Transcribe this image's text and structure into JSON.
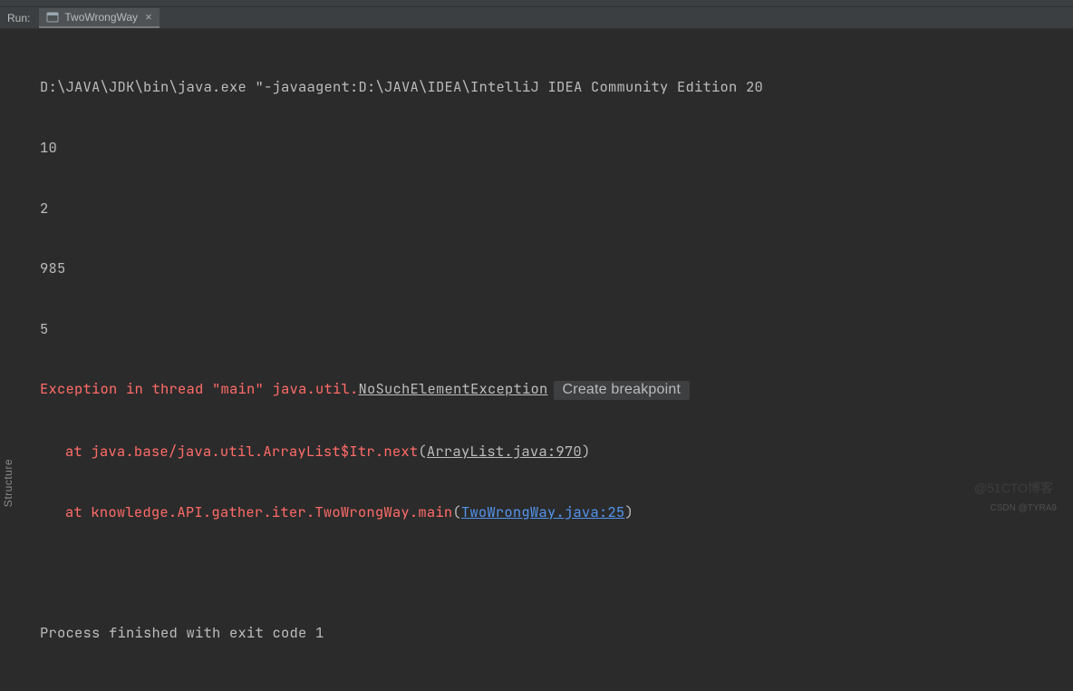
{
  "header": {
    "run_label": "Run:",
    "tab_name": "TwoWrongWay"
  },
  "console": {
    "cmd": "D:\\JAVA\\JDK\\bin\\java.exe \"-javaagent:D:\\JAVA\\IDEA\\IntelliJ IDEA Community Edition 20",
    "out1": "10",
    "out2": "2",
    "out3": "985",
    "out4": "5",
    "exception": {
      "prefix": "Exception in thread \"main\" java.util.",
      "class_link": "NoSuchElementException",
      "breakpoint_label": "Create breakpoint",
      "trace1_prefix": "at java.base/java.util.ArrayList$Itr.next",
      "trace1_open": "(",
      "trace1_link": "ArrayList.java:970",
      "trace1_close": ")",
      "trace2_prefix": "at knowledge.API.gather.iter.TwoWrongWay.main",
      "trace2_open": "(",
      "trace2_link": "TwoWrongWay.java:25",
      "trace2_close": ")"
    },
    "exit": "Process finished with exit code 1"
  },
  "side": {
    "structure": "Structure"
  },
  "watermarks": {
    "w1": "@51CTO博客",
    "w2": "CSDN @TYRA9"
  }
}
